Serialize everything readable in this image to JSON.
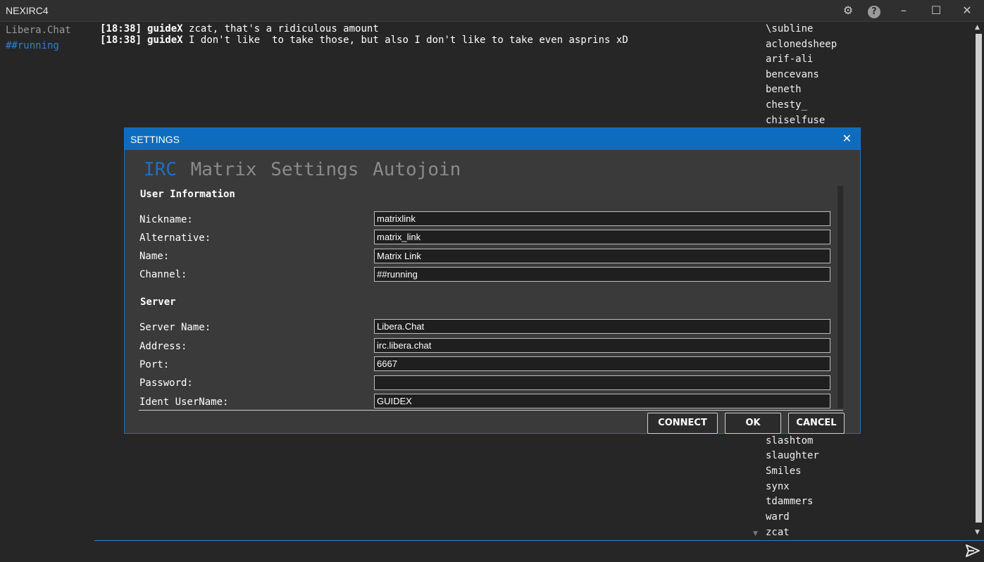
{
  "app": {
    "title": "NEXIRC4"
  },
  "sidebar": {
    "server": "Libera.Chat",
    "channel": "##running"
  },
  "messages": [
    {
      "time": "[18:38]",
      "nick": "guideX",
      "text": "zcat, that's a ridiculous amount"
    },
    {
      "time": "[18:38]",
      "nick": "guideX",
      "text": "I don't like  to take those, but also I don't like to take even asprins xD"
    }
  ],
  "users_top": [
    "\\subline",
    "aclonedsheep",
    "arif-ali",
    "bencevans",
    "beneth",
    "chesty_",
    "chiselfuse"
  ],
  "users_bottom": [
    "slashtom",
    "slaughter",
    "Smiles",
    "synx",
    "tdammers",
    "ward",
    "zcat"
  ],
  "dialog": {
    "title": "SETTINGS",
    "tabs": [
      "IRC",
      "Matrix",
      "Settings",
      "Autojoin"
    ],
    "user_info_title": "User Information",
    "server_title": "Server",
    "fields": {
      "nickname": {
        "label": "Nickname:",
        "value": "matrixlink"
      },
      "alternative": {
        "label": "Alternative:",
        "value": "matrix_link"
      },
      "name": {
        "label": "Name:",
        "value": "Matrix Link"
      },
      "channel": {
        "label": "Channel:",
        "value": "##running"
      },
      "server_name": {
        "label": "Server Name:",
        "value": "Libera.Chat"
      },
      "address": {
        "label": "Address:",
        "value": "irc.libera.chat"
      },
      "port": {
        "label": "Port:",
        "value": "6667"
      },
      "password": {
        "label": "Password:",
        "value": ""
      },
      "ident": {
        "label": "Ident UserName:",
        "value": "GUIDEX"
      }
    },
    "buttons": {
      "connect": "CONNECT",
      "ok": "OK",
      "cancel": "CANCEL"
    }
  },
  "colors": {
    "accent": "#0e6cbf",
    "background": "#262626",
    "active_tab": "#1f6fbf"
  }
}
